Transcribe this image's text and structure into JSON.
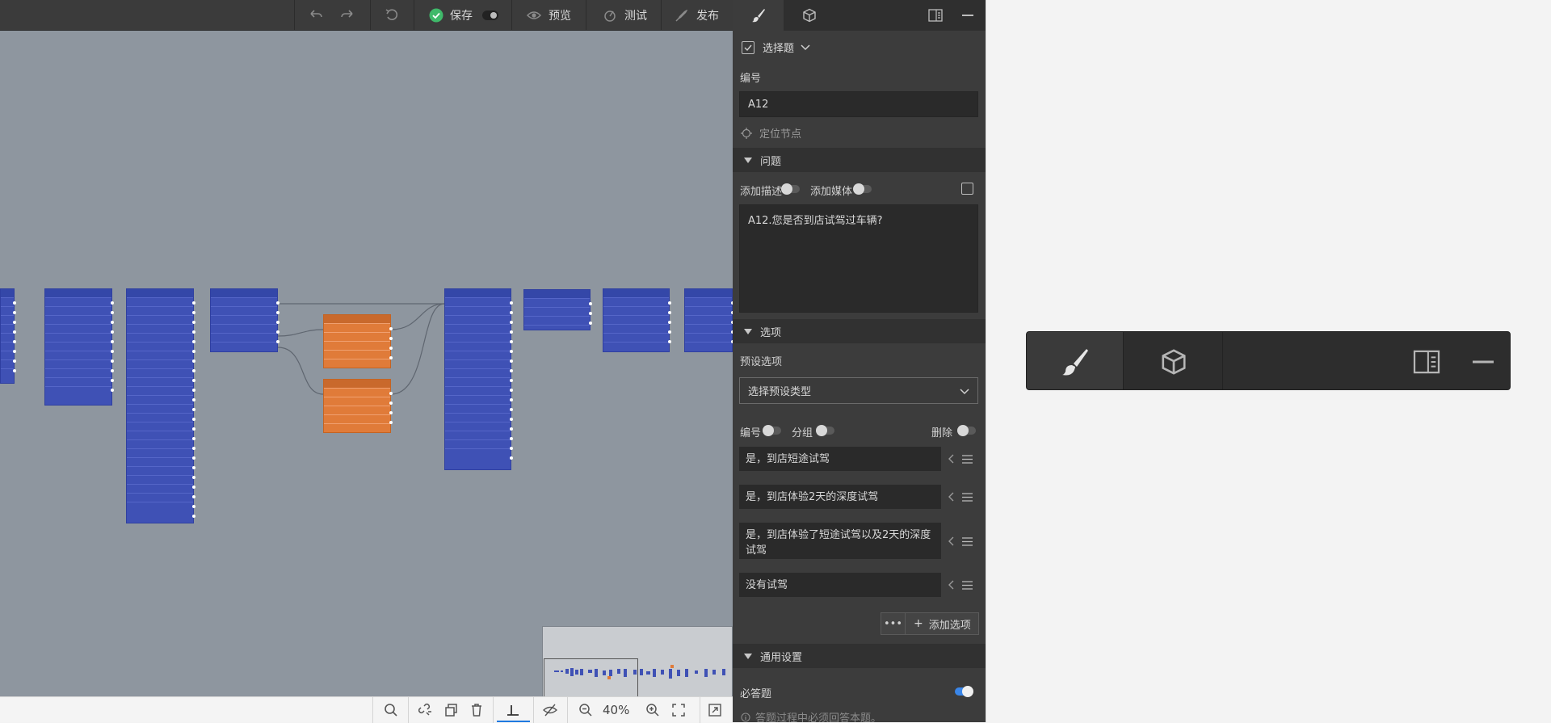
{
  "toolbar": {
    "save_label": "保存",
    "preview_label": "预览",
    "test_label": "测试",
    "publish_label": "发布"
  },
  "canvas": {
    "zoom": "40%"
  },
  "panel": {
    "question_type": "选择题",
    "number_label": "编号",
    "number_value": "A12",
    "locate_node": "定位节点",
    "question_section": "问题",
    "add_description": "添加描述",
    "add_media": "添加媒体",
    "question_text": "A12.您是否到店试驾过车辆?",
    "options_section": "选项",
    "preset_options_label": "预设选项",
    "preset_select": "选择预设类型",
    "numbering_label": "编号",
    "grouping_label": "分组",
    "delete_label": "删除",
    "options": [
      {
        "text": "是，到店短途试驾"
      },
      {
        "text": "是，到店体验2天的深度试驾"
      },
      {
        "text": "是，到店体验了短途试驾以及2天的深度试驾"
      },
      {
        "text": "没有试驾"
      }
    ],
    "add_option": "添加选项",
    "general_section": "通用设置",
    "required_label": "必答题",
    "required_on": true,
    "required_hint": "答题过程中必须回答本题。"
  },
  "colors": {
    "node_blue": "#3f51b5",
    "node_orange": "#e07b39",
    "canvas_bg": "#8e969f",
    "save_check": "#3fb96a",
    "toggle_on": "#3a86e8"
  }
}
